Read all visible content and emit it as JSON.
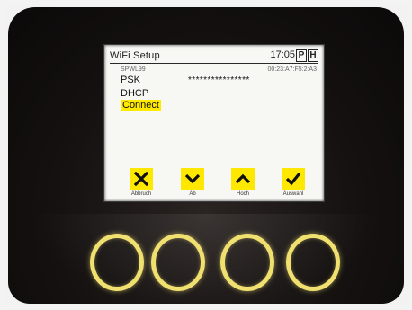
{
  "device": {
    "title": "WiFi Setup",
    "time": "17:05",
    "indicator_p": "P",
    "indicator_h": "H",
    "ssid": "SPWL99",
    "mac": "00:23:A7:F5:2:A3",
    "fields": [
      {
        "label": "PSK",
        "value": "****************"
      },
      {
        "label": "DHCP",
        "value": ""
      },
      {
        "label": "Connect",
        "value": ""
      }
    ],
    "selected": "Connect",
    "softkeys": [
      {
        "label": "Abbruch",
        "icon": "close-icon"
      },
      {
        "label": "Ab",
        "icon": "chevron-down-icon"
      },
      {
        "label": "Hoch",
        "icon": "chevron-up-icon"
      },
      {
        "label": "Auswahl",
        "icon": "check-icon"
      }
    ],
    "colors": {
      "highlight": "#ffea00",
      "button_ring": "#f0e070",
      "screen_bg": "#f7f7f4"
    }
  }
}
